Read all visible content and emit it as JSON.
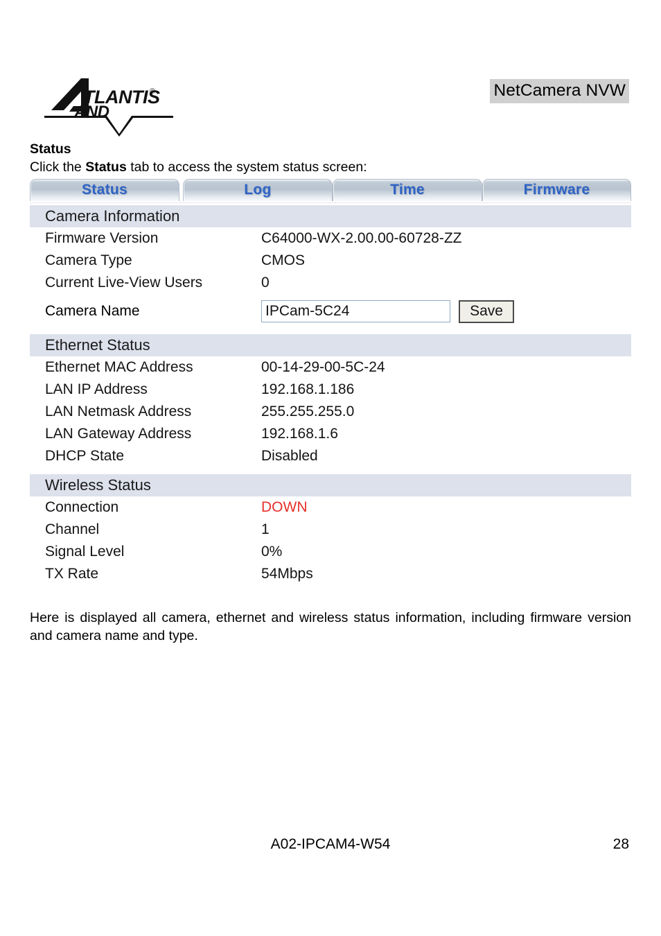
{
  "header": {
    "logo_text": "ATLANTIS LAND",
    "document_title": "NetCamera NVW"
  },
  "body": {
    "section_heading": "Status",
    "intro_prefix": "Click the ",
    "intro_bold": "Status",
    "intro_suffix": " tab to access the system status screen:",
    "outro": "Here is displayed all camera, ethernet and wireless status information, including firmware version and camera name and type."
  },
  "ui": {
    "tabs": [
      {
        "label": "Status"
      },
      {
        "label": "Log"
      },
      {
        "label": "Time"
      },
      {
        "label": "Firmware"
      }
    ],
    "sections": [
      {
        "title": "Camera Information",
        "rows": [
          {
            "label": "Firmware Version",
            "value": "C64000-WX-2.00.00-60728-ZZ"
          },
          {
            "label": "Camera Type",
            "value": "CMOS"
          },
          {
            "label": "Current Live-View Users",
            "value": "0"
          }
        ],
        "input_row": {
          "label": "Camera Name",
          "value": "IPCam-5C24",
          "button_label": "Save"
        }
      },
      {
        "title": "Ethernet Status",
        "rows": [
          {
            "label": "Ethernet MAC Address",
            "value": "00-14-29-00-5C-24"
          },
          {
            "label": "LAN IP Address",
            "value": "192.168.1.186"
          },
          {
            "label": "LAN Netmask Address",
            "value": "255.255.255.0"
          },
          {
            "label": "LAN Gateway Address",
            "value": "192.168.1.6"
          },
          {
            "label": "DHCP State",
            "value": "Disabled"
          }
        ]
      },
      {
        "title": "Wireless Status",
        "rows": [
          {
            "label": "Connection",
            "value": "DOWN",
            "alert": true
          },
          {
            "label": "Channel",
            "value": "1"
          },
          {
            "label": "Signal Level",
            "value": "0%"
          },
          {
            "label": "TX Rate",
            "value": "54Mbps"
          }
        ]
      }
    ]
  },
  "footer": {
    "product_code": "A02-IPCAM4-W54",
    "page_number": "28"
  },
  "colors": {
    "tab_text": "#2f63c4",
    "section_bar": "#dde1ec",
    "alert": "#e8302a",
    "title_highlight": "#d0d0d0"
  }
}
